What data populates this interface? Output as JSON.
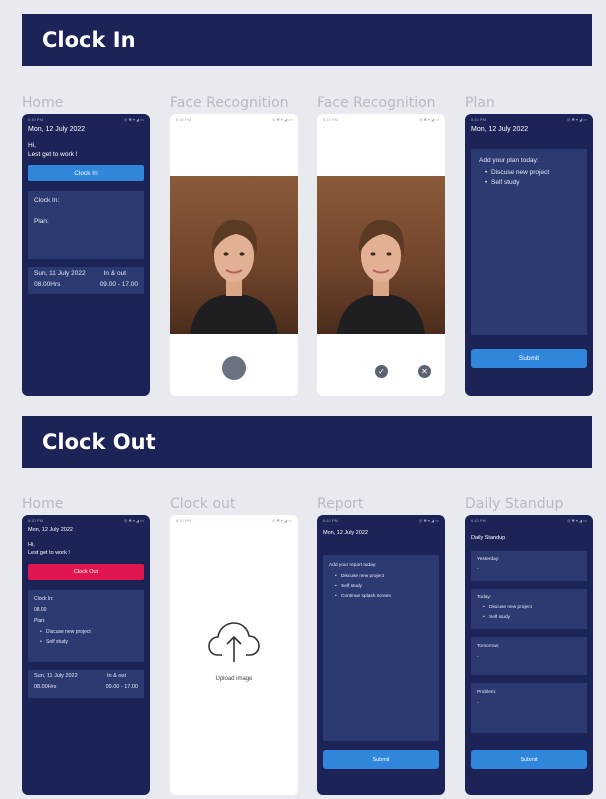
{
  "clock_in": {
    "title": "Clock In",
    "labels": [
      "Home",
      "Face Recognition",
      "Face Recognition",
      "Plan"
    ],
    "home": {
      "status_time": "6:10 PM",
      "date": "Mon, 12 July 2022",
      "greeting_line1": "Hi,",
      "greeting_line2": "Lest get to work !",
      "button": "Clock In",
      "clock_in_label": "Clock In:",
      "plan_label": "Plan:",
      "last_date": "Sun, 11 July 2022",
      "in_out_label": "In & out",
      "hours": "08.00Hrs",
      "range": "09.00 - 17.00"
    },
    "face1": {
      "status_time": "6:10 PM"
    },
    "face2": {
      "status_time": "6:10 PM",
      "confirm_icon": "check-icon",
      "cancel_icon": "close-icon"
    },
    "plan": {
      "status_time": "6:10 PM",
      "date": "Mon, 12 July 2022",
      "heading": "Add your plan today:",
      "items": [
        "Discuse new project",
        "Self study"
      ],
      "submit": "Submit"
    }
  },
  "clock_out": {
    "title": "Clock Out",
    "labels": [
      "Home",
      "Clock out",
      "Report",
      "Daily Standup"
    ],
    "home": {
      "status_time": "6:10 PM",
      "date": "Mon, 12 July 2022",
      "greeting_line1": "Hi,",
      "greeting_line2": "Lest get to work !",
      "button": "Clock Out",
      "clock_in_label": "Clock In:",
      "clock_in_value": "08.00",
      "plan_label": "Plan:",
      "items": [
        "Discuse new project",
        "Self study"
      ],
      "last_date": "Sun, 11 July 2022",
      "in_out_label": "In & out",
      "hours": "08.00Hrs",
      "range": "09.00 - 17.00"
    },
    "upload": {
      "status_time": "6:10 PM",
      "label": "Upload image",
      "icon": "cloud-upload-icon"
    },
    "report": {
      "status_time": "6:10 PM",
      "date": "Mon, 12 July 2022",
      "heading": "Add your report today:",
      "items": [
        "Discuse new project",
        "Self study",
        "Continue splash screen"
      ],
      "submit": "Submit"
    },
    "standup": {
      "status_time": "6:10 PM",
      "title": "Daily Standup",
      "yesterday_label": "Yesterday:",
      "yesterday_value": "-",
      "today_label": "Today:",
      "today_items": [
        "Discuse new project",
        "Self study"
      ],
      "tomorrow_label": "Tomorrow:",
      "tomorrow_value": "-",
      "problem_label": "Problem:",
      "problem_value": "-",
      "submit": "Submit"
    }
  },
  "colors": {
    "navy": "#1c2457",
    "card": "#2d3a72",
    "blue_button": "#2f86da",
    "red_button": "#e0174e",
    "background": "#e9eaef"
  }
}
